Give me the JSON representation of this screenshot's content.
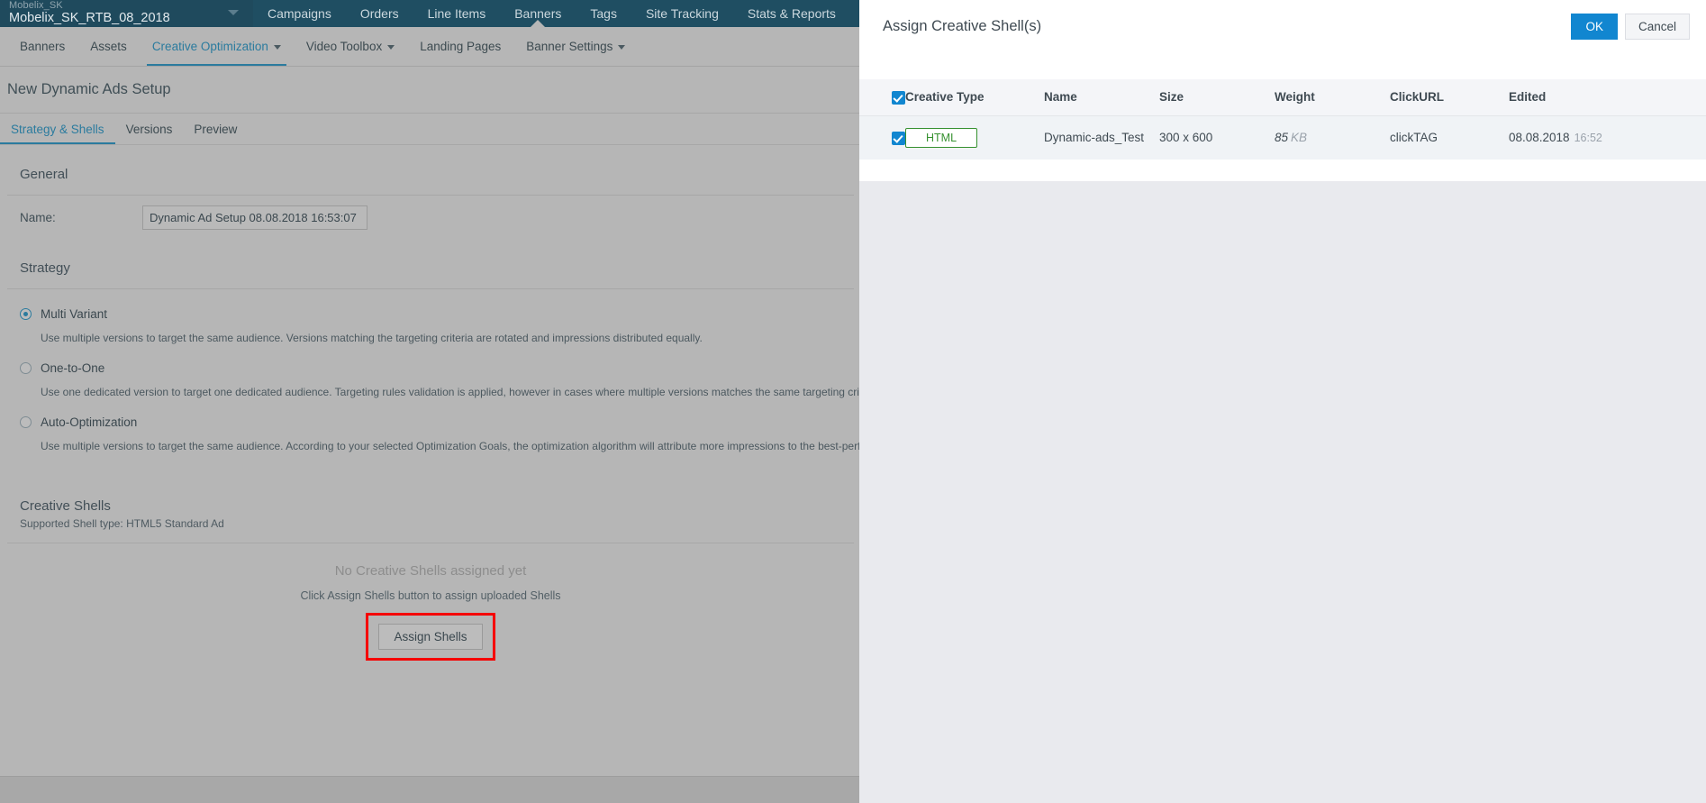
{
  "topbar": {
    "account_small": "Mobelix_SK",
    "account_name": "Mobelix_SK_RTB_08_2018",
    "nav": [
      {
        "label": "Campaigns",
        "active": false
      },
      {
        "label": "Orders",
        "active": false
      },
      {
        "label": "Line Items",
        "active": false
      },
      {
        "label": "Banners",
        "active": true
      },
      {
        "label": "Tags",
        "active": false
      },
      {
        "label": "Site Tracking",
        "active": false
      },
      {
        "label": "Stats & Reports",
        "active": false
      }
    ]
  },
  "subnav": [
    {
      "label": "Banners",
      "active": false,
      "dropdown": false
    },
    {
      "label": "Assets",
      "active": false,
      "dropdown": false
    },
    {
      "label": "Creative Optimization",
      "active": true,
      "dropdown": true
    },
    {
      "label": "Video Toolbox",
      "active": false,
      "dropdown": true
    },
    {
      "label": "Landing Pages",
      "active": false,
      "dropdown": false
    },
    {
      "label": "Banner Settings",
      "active": false,
      "dropdown": true
    }
  ],
  "page": {
    "title": "New Dynamic Ads Setup",
    "tabs": [
      {
        "label": "Strategy & Shells",
        "active": true
      },
      {
        "label": "Versions",
        "active": false
      },
      {
        "label": "Preview",
        "active": false
      }
    ]
  },
  "general": {
    "section_title": "General",
    "name_label": "Name:",
    "name_value": "Dynamic Ad Setup 08.08.2018 16:53:07",
    "name_placeholder": "Name"
  },
  "strategy": {
    "section_title": "Strategy",
    "options": [
      {
        "label": "Multi Variant",
        "selected": true,
        "description": "Use multiple versions to target the same audience. Versions matching the targeting criteria are rotated and impressions distributed equally."
      },
      {
        "label": "One-to-One",
        "selected": false,
        "description": "Use one dedicated version to target one dedicated audience. Targeting rules validation is applied, however in cases where multiple versions matches the same targeting criteria versio"
      },
      {
        "label": "Auto-Optimization",
        "selected": false,
        "description": "Use multiple versions to target the same audience. According to your selected Optimization Goals, the optimization algorithm will attribute more impressions to the best-performing v information."
      }
    ]
  },
  "creative_shells": {
    "section_title": "Creative Shells",
    "supported": "Supported Shell type: HTML5 Standard Ad",
    "empty_title": "No Creative Shells assigned yet",
    "empty_sub": "Click Assign Shells button to assign uploaded Shells",
    "assign_button": "Assign Shells"
  },
  "modal": {
    "title": "Assign Creative Shell(s)",
    "ok_label": "OK",
    "cancel_label": "Cancel",
    "columns": [
      "Creative Type",
      "Name",
      "Size",
      "Weight",
      "ClickURL",
      "Edited"
    ],
    "header_checkbox_checked": true,
    "rows": [
      {
        "checked": true,
        "creative_type": "HTML",
        "name": "Dynamic-ads_Test",
        "size": "300 x 600",
        "weight_value": "85",
        "weight_unit": "KB",
        "clickurl": "clickTAG",
        "edited_date": "08.08.2018",
        "edited_time": "16:52"
      }
    ]
  },
  "colors": {
    "topbar": "#1f4e62",
    "accent": "#2b7b9e",
    "primary_button": "#1186d0",
    "badge_green": "#35912f",
    "highlight_red": "#f50000"
  }
}
